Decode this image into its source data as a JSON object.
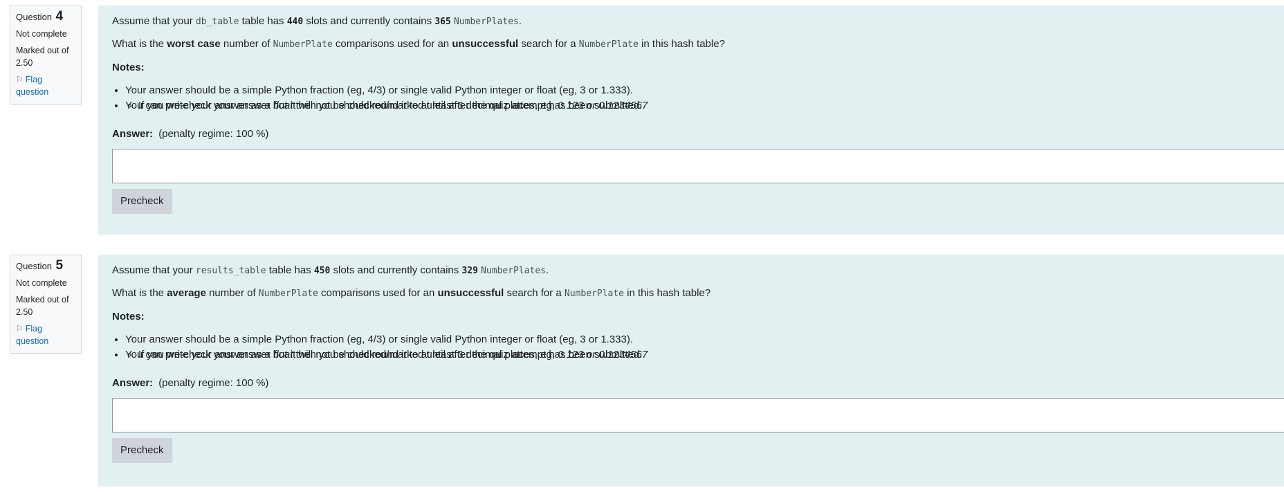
{
  "questions": [
    {
      "label": "Question",
      "number": "4",
      "status": "Not complete",
      "marked": "Marked out of 2.50",
      "flag": "Flag question",
      "stmt_prefix": "Assume that your ",
      "table_name": "db_table",
      "stmt_mid": " table has ",
      "slots": "440",
      "stmt_mid2": " slots and currently contains ",
      "count": "365",
      "type_plural": "NumberPlates",
      "stmt_end": ".",
      "q_prefix": "What is the ",
      "q_bold1": "worst case",
      "q_mid": " number of ",
      "q_type": "NumberPlate",
      "q_mid2": " comparisons used for an ",
      "q_bold2": "unsuccessful",
      "q_mid3": " search for a ",
      "q_type2": "NumberPlate",
      "q_end": " in this hash table?",
      "notes_label": "Notes:",
      "note1": "Your answer should be a simple Python fraction (eg, 4/3) or single valid Python integer or float (eg, 3 or 1.333).",
      "sub_prefix": "If you write your answer as a ",
      "sub_float": "float",
      "sub_mid": " then you should round it to at least 3 decimal places, eg, ",
      "sub_example": "0.123 or 0.1234567",
      "note2": "You can pre-check your answer but it will not be checked/marked until after the quiz attempt has been submitted.",
      "answer_label": "Answer:",
      "penalty": "(penalty regime: 100 %)",
      "answer_value": "",
      "precheck": "Precheck"
    },
    {
      "label": "Question",
      "number": "5",
      "status": "Not complete",
      "marked": "Marked out of 2.50",
      "flag": "Flag question",
      "stmt_prefix": "Assume that your ",
      "table_name": "results_table",
      "stmt_mid": " table has ",
      "slots": "450",
      "stmt_mid2": " slots and currently contains ",
      "count": "329",
      "type_plural": "NumberPlates",
      "stmt_end": ".",
      "q_prefix": "What is the ",
      "q_bold1": "average",
      "q_mid": " number of ",
      "q_type": "NumberPlate",
      "q_mid2": " comparisons used for an ",
      "q_bold2": "unsuccessful",
      "q_mid3": " search for a ",
      "q_type2": "NumberPlate",
      "q_end": " in this hash table?",
      "notes_label": "Notes:",
      "note1": "Your answer should be a simple Python fraction (eg, 4/3) or single valid Python integer or float (eg, 3 or 1.333).",
      "sub_prefix": "If you write your answer as a ",
      "sub_float": "float",
      "sub_mid": " then you should round it to at least 3 decimal places, eg, ",
      "sub_example": "0.123 or 0.1234567",
      "note2": "You can pre-check your answer but it will not be checked/marked until after the quiz attempt has been submitted.",
      "answer_label": "Answer:",
      "penalty": "(penalty regime: 100 %)",
      "answer_value": "",
      "precheck": "Precheck"
    }
  ]
}
